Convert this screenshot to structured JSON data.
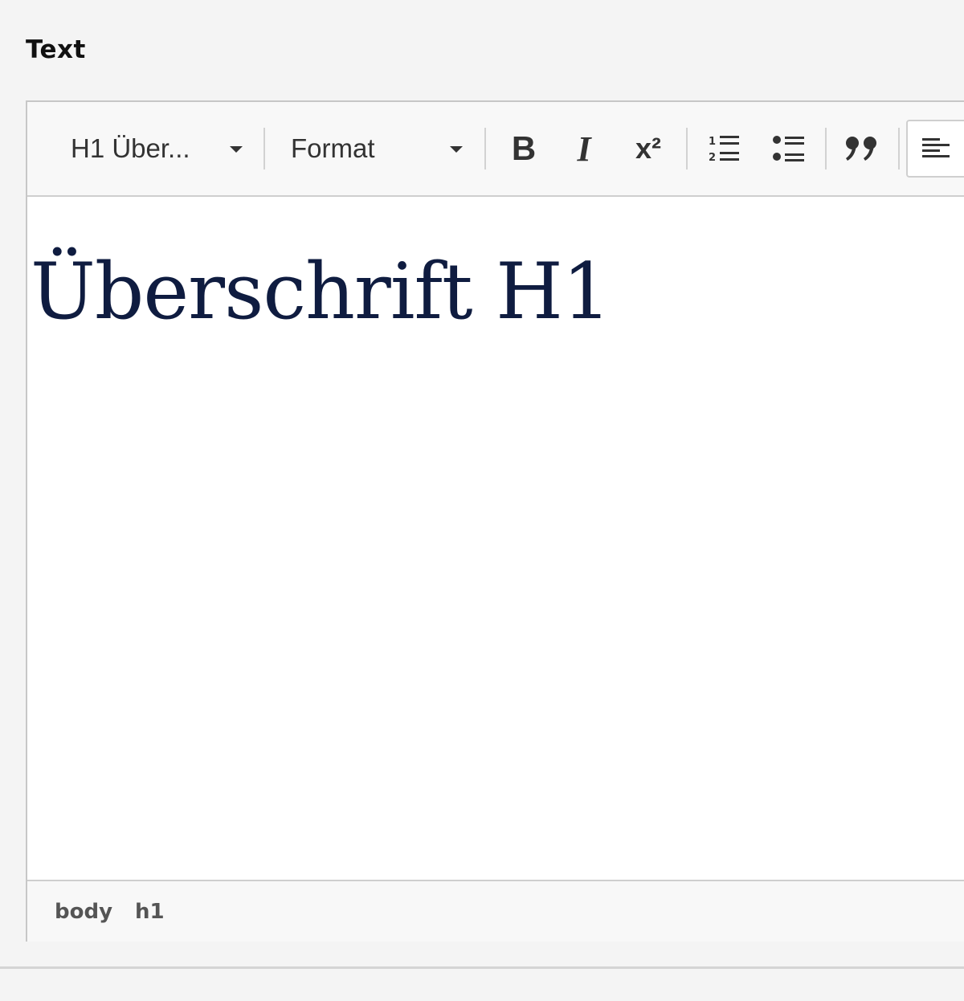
{
  "field": {
    "label": "Text"
  },
  "toolbar": {
    "style_combo": "H1 Über...",
    "format_combo": "Format",
    "buttons": {
      "bold": "B",
      "italic": "I",
      "superscript": "x²",
      "numbered_list": "numbered-list-icon",
      "bulleted_list": "bulleted-list-icon",
      "blockquote": "blockquote-icon",
      "align_left": "align-left-icon"
    },
    "active_button": "align_left"
  },
  "content": {
    "heading": "Überschrift H1"
  },
  "statusbar": {
    "path": [
      "body",
      "h1"
    ]
  },
  "colors": {
    "heading": "#0f1c40",
    "toolbar_bg": "#f8f8f8",
    "border": "#c7c7c7"
  }
}
